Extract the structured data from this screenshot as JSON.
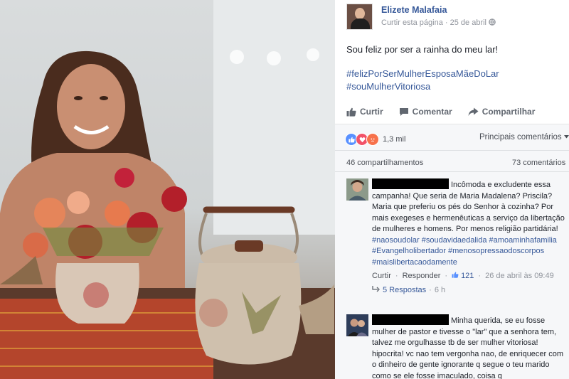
{
  "page": {
    "name": "Elizete Malafaia",
    "like_page": "Curtir esta página",
    "date": "25 de abril",
    "dot": "·"
  },
  "post": {
    "text": "Sou feliz por ser a rainha do meu lar!",
    "hashtags": [
      "#felizPorSerMulherEsposaMãeDoLar",
      "#souMulherVitoriosa"
    ]
  },
  "actions": {
    "like": "Curtir",
    "comment": "Comentar",
    "share": "Compartilhar"
  },
  "stats": {
    "reactions": "1,3 mil",
    "reaction_icons": [
      "like-icon",
      "love-icon",
      "angry-icon"
    ],
    "sort": "Principais comentários",
    "shares": "46 compartilhamentos",
    "comments": "73 comentários"
  },
  "comments": [
    {
      "text": "Incômoda e excludente essa campanha! Que seria de Maria Madalena? Priscila? Maria que preferiu os pés do Senhor à cozinha? Por mais exegeses e hermenêuticas a serviço da libertação de mulheres e homens. Por menos religião partidária!",
      "hashtags": [
        "#naosoudolar",
        "#soudavidaedalida",
        "#amoaminhafamilia",
        "#Evangelholibertador",
        "#menosopressaodoscorpos",
        "#maislibertacaodamente"
      ],
      "reply": "Curtir",
      "respond": "Responder",
      "likes": "121",
      "date": "26 de abril às 09:49",
      "replies": "5 Respostas",
      "replies_age": "6 h"
    },
    {
      "text": "Minha querida, se eu fosse mulher de pastor e tivesse o \"lar\" que a senhora tem, talvez me orgulhasse tb de ser mulher vitoriosa! hipocrita! vc nao tem vergonha nao, de enriquecer com o dinheiro de gente ignorante q segue o teu marido como se ele fosse imaculado, coisa q"
    }
  ],
  "colors": {
    "link": "#365899",
    "meta": "#90949c",
    "like_blue": "#5890ff",
    "love_red": "#f25268",
    "angry_orange": "#f7714b"
  }
}
